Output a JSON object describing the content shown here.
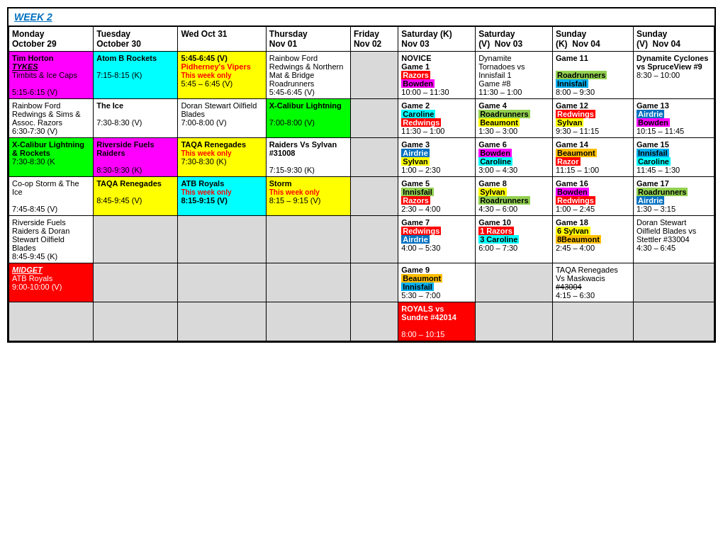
{
  "title": "WEEK 2",
  "headers": {
    "mon": "Monday\nOctober 29",
    "tue": "Tuesday\nOctober 30",
    "wed": "Wed Oct 31",
    "thu": "Thursday\nNov 01",
    "fri": "Friday\nNov 02",
    "satK": "Saturday (K)\nNov 03",
    "satV": "Saturday\n(V)  Nov 03",
    "sunK": "Sunday\n(K)  Nov 04",
    "sunV": "Sunday\n(V)  Nov 04"
  }
}
